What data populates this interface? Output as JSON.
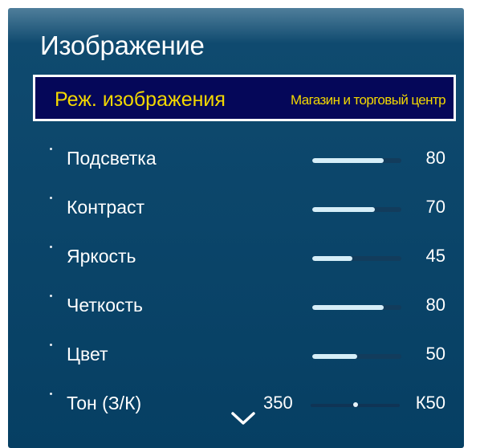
{
  "menu": {
    "title": "Изображение",
    "selected": {
      "label": "Реж. изображения",
      "value": "Магазин и торговый центр"
    },
    "items": [
      {
        "label": "Подсветка",
        "value": "80",
        "level": 0.8
      },
      {
        "label": "Контраст",
        "value": "70",
        "level": 0.7
      },
      {
        "label": "Яркость",
        "value": "45",
        "level": 0.45
      },
      {
        "label": "Четкость",
        "value": "80",
        "level": 0.8
      },
      {
        "label": "Цвет",
        "value": "50",
        "level": 0.5
      }
    ],
    "tone": {
      "label": "Тон (З/К)",
      "left_value": "350",
      "right_value": "К50",
      "balance": 0.5
    }
  },
  "colors": {
    "panel": "#0f4a6f",
    "selected_bg": "#050759",
    "selected_text": "#f3d800",
    "slider_fill": "#d6eef8"
  },
  "icons": {
    "more": "chevron-down-icon"
  }
}
